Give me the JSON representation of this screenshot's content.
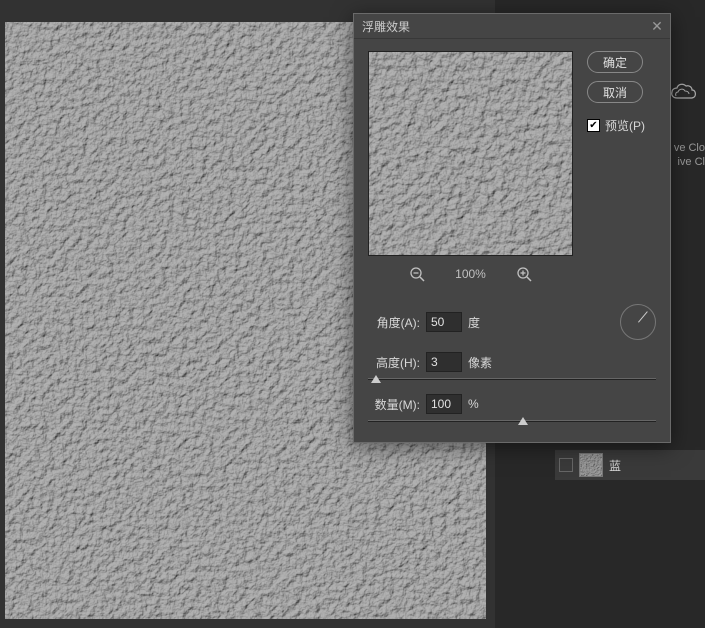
{
  "dialog": {
    "title": "浮雕效果",
    "ok_label": "确定",
    "cancel_label": "取消",
    "preview_label": "预览(P)",
    "zoom_level": "100%",
    "params": {
      "angle": {
        "label": "角度(A):",
        "value": "50",
        "unit": "度"
      },
      "height": {
        "label": "高度(H):",
        "value": "3",
        "unit": "像素"
      },
      "amount": {
        "label": "数量(M):",
        "value": "100",
        "unit": "%"
      }
    }
  },
  "layer": {
    "name": "蓝"
  },
  "cloud": {
    "line1": "ve Clo",
    "line2": "ive Cl"
  }
}
